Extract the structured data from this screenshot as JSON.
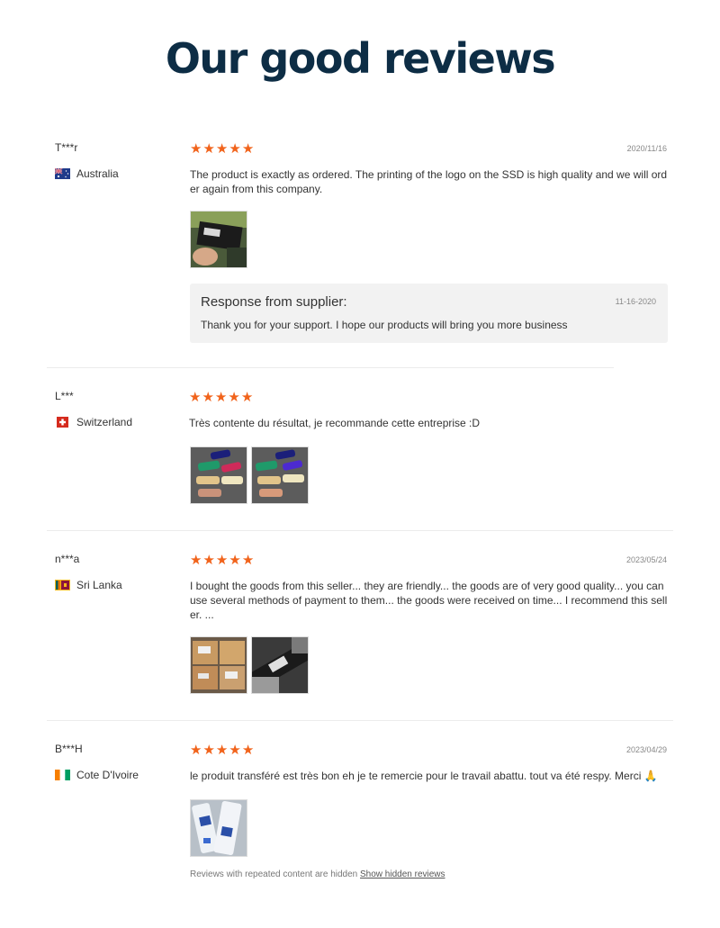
{
  "page_title": "Our good reviews",
  "reviews": [
    {
      "name": "T***r",
      "country": "Australia",
      "flag_icon": "australia-flag-icon",
      "rating": 5,
      "date": "2020/11/16",
      "text": "The product is exactly as ordered. The printing of the logo on the SSD is high quality and we will order again from this company.",
      "image_count": 1,
      "response": {
        "title": "Response from supplier:",
        "date": "11-16-2020",
        "text": "Thank you for your support. I hope our products will bring you more business"
      }
    },
    {
      "name": "L***",
      "country": "Switzerland",
      "flag_icon": "switzerland-flag-icon",
      "rating": 5,
      "date": "",
      "text": "Très contente du résultat, je recommande cette entreprise :D",
      "image_count": 2
    },
    {
      "name": "n***a",
      "country": "Sri Lanka",
      "flag_icon": "sri-lanka-flag-icon",
      "rating": 5,
      "date": "2023/05/24",
      "text": "I bought the goods from this seller... they are friendly... the goods are of very good quality... you can use several methods of payment to them... the goods were received on time... I recommend this seller. ...",
      "image_count": 2
    },
    {
      "name": "B***H",
      "country": "Cote D'Ivoire",
      "flag_icon": "cote-divoire-flag-icon",
      "rating": 5,
      "date": "2023/04/29",
      "text": "le produit transféré est très bon eh je te remercie pour le travail abattu. tout va été respy. Merci 🙏",
      "image_count": 1
    }
  ],
  "footer": {
    "text": "Reviews with repeated content are hidden",
    "link": "Show hidden reviews"
  },
  "colors": {
    "title": "#0d2d45",
    "star": "#f1631b",
    "response_bg": "#f2f2f2"
  }
}
